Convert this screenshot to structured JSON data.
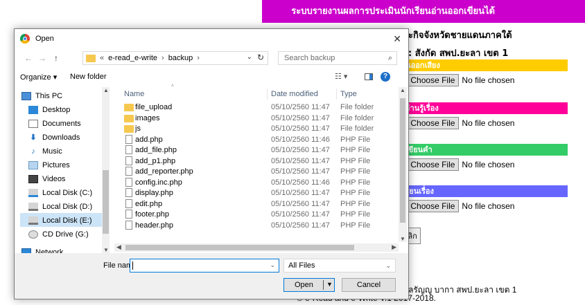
{
  "background": {
    "header": "ระบบรายงานผลการประเมินนักเรียนอ่านออกเขียนได้",
    "line1": "ะกิจจังหวัดชายแดนภาคใต้",
    "line2": ": สังกัด สพป.ยะลา เขต 1",
    "sections": [
      {
        "title": "่านออกเสียง",
        "color": "#ffcc00"
      },
      {
        "title": "รอ่านรู้เรื่อง",
        "color": "#ff0099"
      },
      {
        "title": "รเขียนคำ",
        "color": "#33cc66"
      },
      {
        "title": "เขียนเรื่อง",
        "color": "#6666ff"
      }
    ],
    "choose_file_label": "Choose File",
    "no_file_label": "No file chosen",
    "cut_prefix": "ง",
    "cancel_label": "กเลิก",
    "footer1": "ลรัญญู บากา สพป.ยะลา เขต 1",
    "footer2": "© e-Read and e-Write V.1 2017-2018."
  },
  "dialog": {
    "title": "Open",
    "close": "✕",
    "nav_back": "←",
    "nav_forward": "→",
    "nav_up": "↑",
    "address": {
      "overflow": "«",
      "crumbs": [
        "e-read_e-write",
        "backup"
      ],
      "separator": "›"
    },
    "search_placeholder": "Search backup",
    "toolbar": {
      "organize": "Organize ▾",
      "new_folder": "New folder"
    },
    "sidebar": [
      {
        "label": "This PC",
        "icon": "computer-icon"
      },
      {
        "label": "Desktop",
        "icon": "desktop-icon"
      },
      {
        "label": "Documents",
        "icon": "documents-icon"
      },
      {
        "label": "Downloads",
        "icon": "downloads-icon"
      },
      {
        "label": "Music",
        "icon": "music-icon"
      },
      {
        "label": "Pictures",
        "icon": "pictures-icon"
      },
      {
        "label": "Videos",
        "icon": "videos-icon"
      },
      {
        "label": "Local Disk (C:)",
        "icon": "drive-icon"
      },
      {
        "label": "Local Disk (D:)",
        "icon": "drive-icon"
      },
      {
        "label": "Local Disk (E:)",
        "icon": "drive-icon",
        "selected": true
      },
      {
        "label": "CD Drive (G:)",
        "icon": "cd-drive-icon"
      },
      {
        "label": "Network",
        "icon": "network-icon"
      }
    ],
    "columns": {
      "name": "Name",
      "date": "Date modified",
      "type": "Type"
    },
    "files": [
      {
        "name": "file_upload",
        "date": "05/10/2560 11:47",
        "type": "File folder",
        "kind": "folder"
      },
      {
        "name": "images",
        "date": "05/10/2560 11:47",
        "type": "File folder",
        "kind": "folder"
      },
      {
        "name": "js",
        "date": "05/10/2560 11:47",
        "type": "File folder",
        "kind": "folder"
      },
      {
        "name": "add.php",
        "date": "05/10/2560 11:46",
        "type": "PHP File",
        "kind": "file"
      },
      {
        "name": "add_file.php",
        "date": "05/10/2560 11:47",
        "type": "PHP File",
        "kind": "file"
      },
      {
        "name": "add_p1.php",
        "date": "05/10/2560 11:47",
        "type": "PHP File",
        "kind": "file"
      },
      {
        "name": "add_reporter.php",
        "date": "05/10/2560 11:47",
        "type": "PHP File",
        "kind": "file"
      },
      {
        "name": "config.inc.php",
        "date": "05/10/2560 11:46",
        "type": "PHP File",
        "kind": "file"
      },
      {
        "name": "display.php",
        "date": "05/10/2560 11:47",
        "type": "PHP File",
        "kind": "file"
      },
      {
        "name": "edit.php",
        "date": "05/10/2560 11:47",
        "type": "PHP File",
        "kind": "file"
      },
      {
        "name": "footer.php",
        "date": "05/10/2560 11:47",
        "type": "PHP File",
        "kind": "file"
      },
      {
        "name": "header.php",
        "date": "05/10/2560 11:47",
        "type": "PHP File",
        "kind": "file"
      }
    ],
    "file_name_label": "File name:",
    "file_name_value": "",
    "file_type": "All Files",
    "open_label": "Open",
    "cancel_label": "Cancel"
  }
}
